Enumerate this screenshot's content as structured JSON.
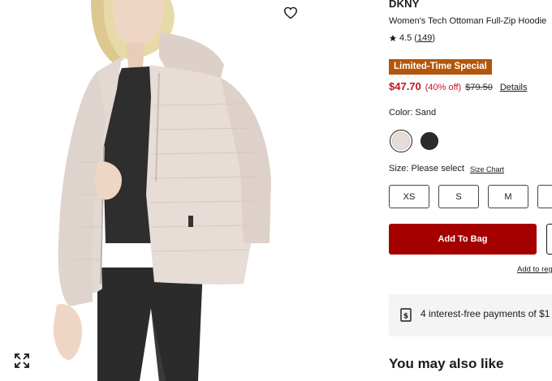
{
  "product": {
    "brand": "DKNY",
    "name": "Women's Tech Ottoman Full-Zip Hoodie",
    "rating": "4.5",
    "review_count": "149",
    "promo_badge": "Limited-Time Special",
    "price_now": "$47.70",
    "price_discount": "(40% off)",
    "price_was": "$79.50",
    "details_link": "Details"
  },
  "color": {
    "label": "Color: Sand",
    "swatches": [
      {
        "name": "Sand",
        "hex": "#e6dcd8",
        "selected": true
      },
      {
        "name": "Black",
        "hex": "#2b2b2b",
        "selected": false
      }
    ]
  },
  "size": {
    "label": "Size: Please select",
    "chart_link": "Size Chart",
    "options": [
      "XS",
      "S",
      "M"
    ]
  },
  "actions": {
    "add_to_bag": "Add To Bag",
    "add_to_registry": "Add to reg"
  },
  "payments": {
    "text": "4 interest-free payments of $1"
  },
  "recommendations": {
    "title": "You may also like"
  },
  "colors": {
    "accent_red": "#a50000",
    "sale_red": "#c4121e",
    "promo_orange": "#b4560a"
  },
  "icons": {
    "wishlist": "heart-icon",
    "expand": "expand-icon",
    "rating_star": "star-icon",
    "payments": "dollar-tag-icon"
  }
}
